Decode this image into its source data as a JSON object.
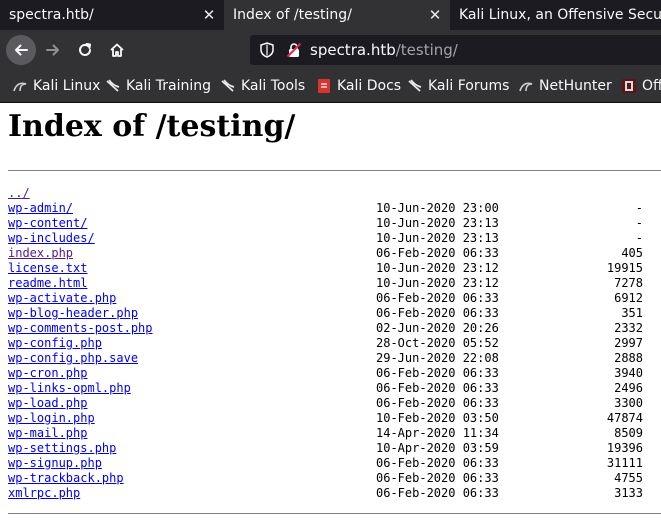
{
  "tabs": [
    {
      "label": "spectra.htb/",
      "close": "✕"
    },
    {
      "label": "Index of /testing/",
      "close": "✕"
    },
    {
      "label": "Kali Linux, an Offensive Security"
    }
  ],
  "url": {
    "host": "spectra.htb",
    "path": "/testing/"
  },
  "bookmarks": [
    "Kali Linux",
    "Kali Training",
    "Kali Tools",
    "Kali Docs",
    "Kali Forums",
    "NetHunter",
    "Off"
  ],
  "heading": "Index of /testing/",
  "listing": [
    {
      "name": "../",
      "date": "",
      "size": "",
      "visited": true
    },
    {
      "name": "wp-admin/",
      "date": "10-Jun-2020 23:00",
      "size": "-"
    },
    {
      "name": "wp-content/",
      "date": "10-Jun-2020 23:13",
      "size": "-"
    },
    {
      "name": "wp-includes/",
      "date": "10-Jun-2020 23:13",
      "size": "-"
    },
    {
      "name": "index.php",
      "date": "06-Feb-2020 06:33",
      "size": "405",
      "visited": true
    },
    {
      "name": "license.txt",
      "date": "10-Jun-2020 23:12",
      "size": "19915"
    },
    {
      "name": "readme.html",
      "date": "10-Jun-2020 23:12",
      "size": "7278"
    },
    {
      "name": "wp-activate.php",
      "date": "06-Feb-2020 06:33",
      "size": "6912"
    },
    {
      "name": "wp-blog-header.php",
      "date": "06-Feb-2020 06:33",
      "size": "351"
    },
    {
      "name": "wp-comments-post.php",
      "date": "02-Jun-2020 20:26",
      "size": "2332"
    },
    {
      "name": "wp-config.php",
      "date": "28-Oct-2020 05:52",
      "size": "2997"
    },
    {
      "name": "wp-config.php.save",
      "date": "29-Jun-2020 22:08",
      "size": "2888"
    },
    {
      "name": "wp-cron.php",
      "date": "06-Feb-2020 06:33",
      "size": "3940"
    },
    {
      "name": "wp-links-opml.php",
      "date": "06-Feb-2020 06:33",
      "size": "2496"
    },
    {
      "name": "wp-load.php",
      "date": "06-Feb-2020 06:33",
      "size": "3300"
    },
    {
      "name": "wp-login.php",
      "date": "10-Feb-2020 03:50",
      "size": "47874"
    },
    {
      "name": "wp-mail.php",
      "date": "14-Apr-2020 11:34",
      "size": "8509"
    },
    {
      "name": "wp-settings.php",
      "date": "10-Apr-2020 03:59",
      "size": "19396"
    },
    {
      "name": "wp-signup.php",
      "date": "06-Feb-2020 06:33",
      "size": "31111"
    },
    {
      "name": "wp-trackback.php",
      "date": "06-Feb-2020 06:33",
      "size": "4755"
    },
    {
      "name": "xmlrpc.php",
      "date": "06-Feb-2020 06:33",
      "size": "3133"
    }
  ],
  "colors": {
    "link": "#0000ee",
    "visited": "#551a8b",
    "chrome": "#323234",
    "tabbar": "#0c0c0d"
  }
}
